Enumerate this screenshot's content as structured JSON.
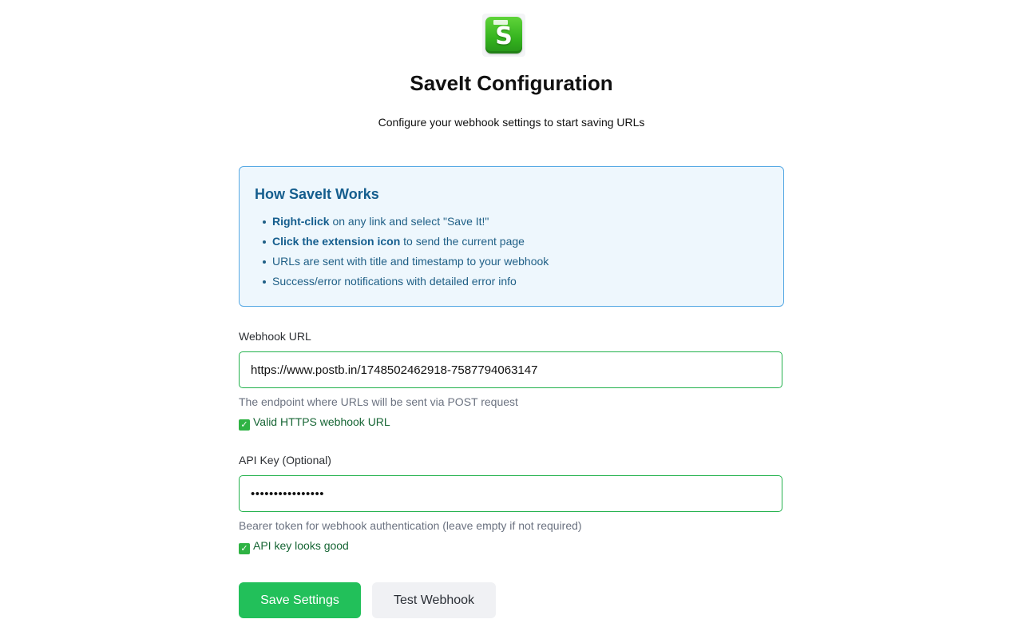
{
  "app": {
    "logo_icon": "floppy-disk-dollar-icon",
    "logo_letter": "S",
    "title": "SaveIt Configuration",
    "subtitle": "Configure your webhook settings to start saving URLs"
  },
  "info": {
    "title": "How SaveIt Works",
    "items": [
      {
        "bold": "Right-click",
        "text": " on any link and select \"Save It!\""
      },
      {
        "bold": "Click the extension icon",
        "text": " to send the current page"
      },
      {
        "bold": "",
        "text": "URLs are sent with title and timestamp to your webhook"
      },
      {
        "bold": "",
        "text": "Success/error notifications with detailed error info"
      }
    ]
  },
  "webhook": {
    "label": "Webhook URL",
    "value": "https://www.postb.in/1748502462918-7587794063147",
    "hint": "The endpoint where URLs will be sent via POST request",
    "status": "Valid HTTPS webhook URL",
    "status_icon": "check-mark-icon"
  },
  "api_key": {
    "label": "API Key (Optional)",
    "value": "••••••••••••••••",
    "hint": "Bearer token for webhook authentication (leave empty if not required)",
    "status": "API key looks good",
    "status_icon": "check-mark-icon"
  },
  "buttons": {
    "save": "Save Settings",
    "test": "Test Webhook"
  },
  "colors": {
    "accent_green": "#22c05a",
    "valid_border": "#22b14c",
    "info_border": "#57a9e4",
    "info_bg": "#eef7fd",
    "info_text": "#155e8e"
  }
}
